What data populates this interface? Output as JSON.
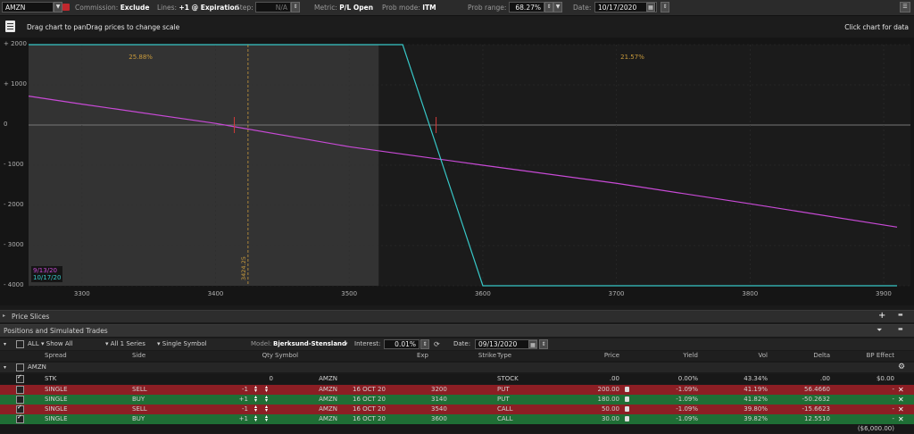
{
  "topbar": {
    "symbol": "AMZN",
    "commission_label": "Commission:",
    "commission_value": "Exclude",
    "lines_label": "Lines:",
    "lines_value": "+1 @ Expiration",
    "step_label": "Step:",
    "step_value": "N/A",
    "metric_label": "Metric:",
    "metric_value": "P/L Open",
    "prob_mode_label": "Prob mode:",
    "prob_mode_value": "ITM",
    "prob_range_label": "Prob range:",
    "prob_range_value": "68.27%",
    "date_label": "Date:",
    "date_value": "10/17/2020"
  },
  "chart_header": {
    "hint": "Drag chart to panDrag prices to change scale",
    "click_hint": "Click chart for data"
  },
  "chart_data": {
    "type": "line",
    "y_ticks": [
      "+ 2000",
      "+ 1000",
      "0",
      "- 1000",
      "- 2000",
      "- 3000",
      "- 4000"
    ],
    "x_ticks": [
      "3300",
      "3400",
      "3500",
      "3600",
      "3700",
      "3800",
      "3900"
    ],
    "xlim": [
      3260,
      3920
    ],
    "ylim": [
      -4000,
      2000
    ],
    "prob_left_label": "25.88%",
    "prob_right_label": "21.57%",
    "price_marker_label": "3424.25",
    "series": [
      {
        "name": "9/13/20",
        "color": "#c84ad6",
        "x": [
          3260,
          3300,
          3400,
          3500,
          3600,
          3700,
          3800,
          3910
        ],
        "y": [
          720,
          520,
          40,
          -540,
          -1000,
          -1450,
          -1960,
          -2540
        ]
      },
      {
        "name": "10/17/20",
        "color": "#37c7c7",
        "x": [
          3260,
          3540,
          3600,
          3610,
          3910
        ],
        "y": [
          2000,
          2000,
          -4000,
          -4000,
          -4000
        ]
      }
    ]
  },
  "price_slices": {
    "label": "Price Slices"
  },
  "positions": {
    "title": "Positions and Simulated Trades",
    "filter_all": "ALL",
    "show_all": "Show All",
    "series": "All 1 Series",
    "single_symbol": "Single Symbol",
    "model_label": "Model:",
    "model_value": "Bjerksund-Stensland",
    "interest_label": "Interest:",
    "interest_value": "0.01%",
    "date_label": "Date:",
    "date_value": "09/13/2020",
    "columns": [
      "Spread",
      "Side",
      "Qty",
      "Symbol",
      "Exp",
      "Strike",
      "Type",
      "Price",
      "Yield",
      "Vol",
      "Delta",
      "BP Effect"
    ],
    "group": "AMZN",
    "stock_row": {
      "spread": "STK",
      "qty": "0",
      "symbol": "AMZN",
      "type": "STOCK",
      "price": ".00",
      "yield": "0.00%",
      "vol": "43.34%",
      "delta": ".00",
      "bp": "$0.00"
    },
    "rows": [
      {
        "spread": "SINGLE",
        "side": "SELL",
        "qty": "-1",
        "symbol": "AMZN",
        "exp": "16 OCT 20",
        "strike": "3200",
        "type": "PUT",
        "price": "200.00",
        "yield": "-1.09%",
        "vol": "41.19%",
        "delta": "56.4660",
        "bp": "-"
      },
      {
        "spread": "SINGLE",
        "side": "BUY",
        "qty": "+1",
        "symbol": "AMZN",
        "exp": "16 OCT 20",
        "strike": "3140",
        "type": "PUT",
        "price": "180.00",
        "yield": "-1.09%",
        "vol": "41.82%",
        "delta": "-50.2632",
        "bp": "-"
      },
      {
        "spread": "SINGLE",
        "side": "SELL",
        "qty": "-1",
        "symbol": "AMZN",
        "exp": "16 OCT 20",
        "strike": "3540",
        "type": "CALL",
        "price": "50.00",
        "yield": "-1.09%",
        "vol": "39.80%",
        "delta": "-15.6623",
        "bp": "-"
      },
      {
        "spread": "SINGLE",
        "side": "BUY",
        "qty": "+1",
        "symbol": "AMZN",
        "exp": "16 OCT 20",
        "strike": "3600",
        "type": "CALL",
        "price": "30.00",
        "yield": "-1.09%",
        "vol": "39.82%",
        "delta": "12.5510",
        "bp": "-"
      }
    ],
    "total_bp": "($6,000.00)"
  },
  "colors": {
    "sell_row": "#8c1e24",
    "buy_row": "#1f6e35",
    "purple_line": "#c84ad6",
    "cyan_line": "#37c7c7",
    "prob_text": "#c89a3c"
  }
}
